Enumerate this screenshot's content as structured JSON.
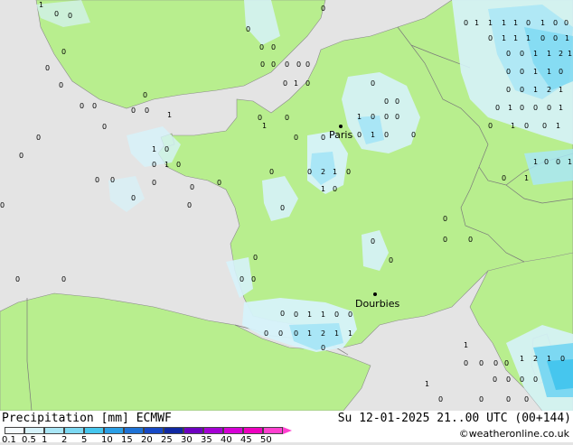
{
  "map": {
    "cities": [
      {
        "name": "Paris"
      },
      {
        "name": "Dourbies"
      }
    ],
    "point_values": [
      "0",
      "1",
      "2"
    ]
  },
  "footer": {
    "title": "Precipitation [mm]",
    "model": "ECMWF",
    "datetime": "Su 12-01-2025 21..00 UTC (00+144)",
    "copyright": "©weatheronline.co.uk",
    "scale_labels": [
      "0.1",
      "0.5",
      "1",
      "2",
      "5",
      "10",
      "15",
      "20",
      "25",
      "30",
      "35",
      "40",
      "45",
      "50"
    ],
    "scale_colors": [
      "#f5fbfd",
      "#d6f2fa",
      "#a9e6f6",
      "#7cd8f2",
      "#46c6ee",
      "#2b9fe6",
      "#1e72d6",
      "#1749c6",
      "#1028a2",
      "#6d00c0",
      "#a400d4",
      "#d600d6",
      "#ee00c0",
      "#ff40d0"
    ]
  }
}
